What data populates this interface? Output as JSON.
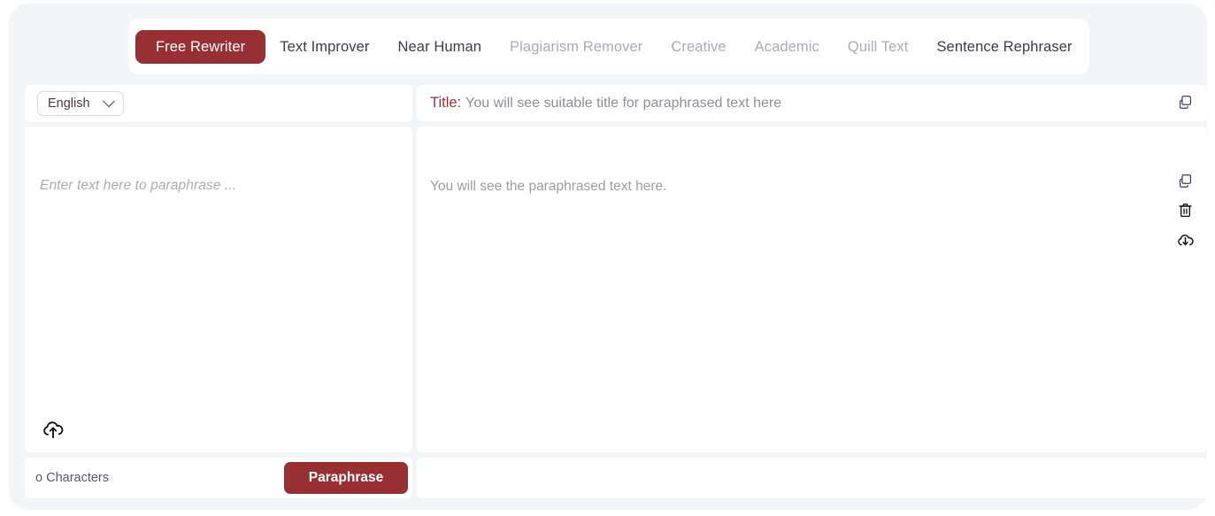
{
  "theme": {
    "accent": "#982f33",
    "page_bg": "#f2f6f9",
    "card_bg": "#ffffff",
    "muted_text": "#a9adb8",
    "title_label_color": "#9b3136"
  },
  "tabs": [
    {
      "label": "Free Rewriter",
      "state": "active"
    },
    {
      "label": "Text Improver",
      "state": "normal"
    },
    {
      "label": "Near Human",
      "state": "normal"
    },
    {
      "label": "Plagiarism Remover",
      "state": "muted"
    },
    {
      "label": "Creative",
      "state": "muted"
    },
    {
      "label": "Academic",
      "state": "muted"
    },
    {
      "label": "Quill Text",
      "state": "muted"
    },
    {
      "label": "Sentence Rephraser",
      "state": "normal"
    }
  ],
  "input_panel": {
    "language": {
      "selected": "English",
      "icon": "chevron-down-icon"
    },
    "placeholder": "Enter text here to paraphrase ...",
    "value": "",
    "upload_icon": "upload-cloud-icon",
    "character_count": "o Characters",
    "submit_label": "Paraphrase"
  },
  "output_panel": {
    "title_label": "Title:",
    "title_text": "You will see suitable title for paraphrased text here",
    "title_copy_icon": "copy-icon",
    "body_text": "You will see the paraphrased text here.",
    "tools": [
      {
        "icon": "copy-icon",
        "name": "copy-output-button"
      },
      {
        "icon": "trash-icon",
        "name": "delete-output-button"
      },
      {
        "icon": "download-cloud-icon",
        "name": "download-output-button"
      }
    ]
  }
}
